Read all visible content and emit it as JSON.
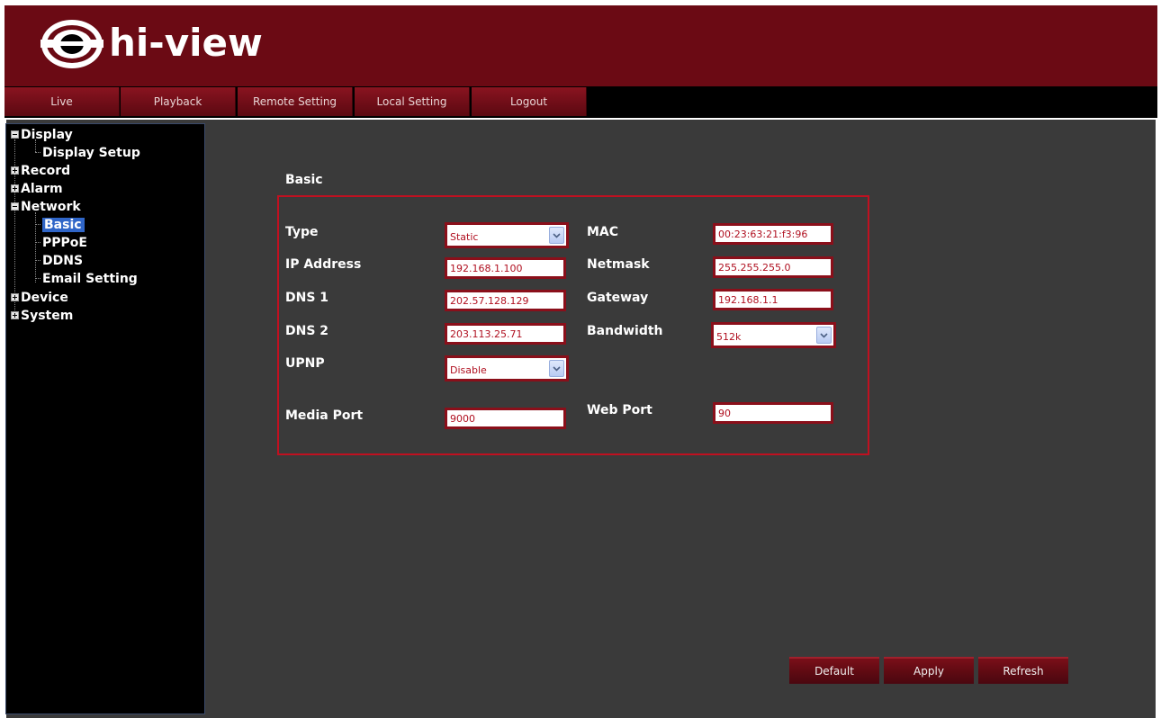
{
  "app": {
    "brand": "hi-view"
  },
  "nav": {
    "tabs": [
      "Live",
      "Playback",
      "Remote Setting",
      "Local Setting",
      "Logout"
    ]
  },
  "sidebar": {
    "items": [
      {
        "label": "Display",
        "expanded": true
      },
      {
        "label": "Display Setup"
      },
      {
        "label": "Record",
        "expanded": false
      },
      {
        "label": "Alarm",
        "expanded": false
      },
      {
        "label": "Network",
        "expanded": true
      },
      {
        "label": "Basic",
        "selected": true
      },
      {
        "label": "PPPoE"
      },
      {
        "label": "DDNS"
      },
      {
        "label": "Email Setting"
      },
      {
        "label": "Device",
        "expanded": false
      },
      {
        "label": "System",
        "expanded": false
      }
    ]
  },
  "form": {
    "title": "Basic",
    "type": {
      "label": "Type",
      "value": "Static"
    },
    "ip": {
      "label": "IP Address",
      "value": "192.168.1.100"
    },
    "dns1": {
      "label": "DNS 1",
      "value": "202.57.128.129"
    },
    "dns2": {
      "label": "DNS 2",
      "value": "203.113.25.71"
    },
    "upnp": {
      "label": "UPNP",
      "value": "Disable"
    },
    "media_port": {
      "label": "Media Port",
      "value": "9000"
    },
    "mac": {
      "label": "MAC",
      "value": "00:23:63:21:f3:96"
    },
    "netmask": {
      "label": "Netmask",
      "value": "255.255.255.0"
    },
    "gateway": {
      "label": "Gateway",
      "value": "192.168.1.1"
    },
    "bandwidth": {
      "label": "Bandwidth",
      "value": "512k"
    },
    "web_port": {
      "label": "Web Port",
      "value": "90"
    }
  },
  "actions": {
    "default": "Default",
    "apply": "Apply",
    "refresh": "Refresh"
  },
  "colors": {
    "header_bg": "#6b0a14",
    "accent_red": "#c01020",
    "content_bg": "#3a3a3a",
    "selection": "#3066c8"
  }
}
